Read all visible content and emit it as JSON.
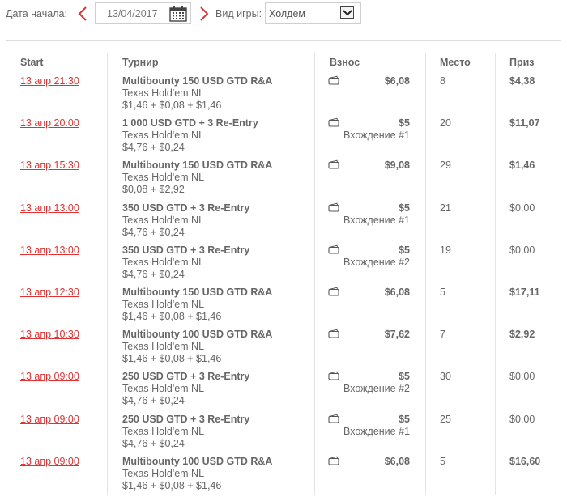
{
  "filters": {
    "date_label": "Дата начала:",
    "date_value": "13/04/2017",
    "game_label": "Вид игры:",
    "game_value": "Холдем"
  },
  "columns": {
    "start": "Start",
    "tournament": "Турнир",
    "buyin": "Взнос",
    "place": "Место",
    "prize": "Приз"
  },
  "rows": [
    {
      "start": "13 апр 21:30",
      "name": "Multibounty 150 USD GTD R&A",
      "game": "Texas Hold'em NL",
      "fee": "$1,46 + $0,08 + $1,46",
      "buyin": "$6,08",
      "entry": "",
      "place": "8",
      "prize": "$4,38",
      "won": true
    },
    {
      "start": "13 апр 20:00",
      "name": "1 000 USD GTD + 3 Re-Entry",
      "game": "Texas Hold'em NL",
      "fee": "$4,76 + $0,24",
      "buyin": "$5",
      "entry": "Вхождение #1",
      "place": "20",
      "prize": "$11,07",
      "won": true
    },
    {
      "start": "13 апр 15:30",
      "name": "Multibounty 150 USD GTD R&A",
      "game": "Texas Hold'em NL",
      "fee": "$0,08 + $2,92",
      "buyin": "$9,08",
      "entry": "",
      "place": "29",
      "prize": "$1,46",
      "won": true
    },
    {
      "start": "13 апр 13:00",
      "name": "350 USD GTD + 3 Re-Entry",
      "game": "Texas Hold'em NL",
      "fee": "$4,76 + $0,24",
      "buyin": "$5",
      "entry": "Вхождение #1",
      "place": "21",
      "prize": "$0,00",
      "won": false
    },
    {
      "start": "13 апр 13:00",
      "name": "350 USD GTD + 3 Re-Entry",
      "game": "Texas Hold'em NL",
      "fee": "$4,76 + $0,24",
      "buyin": "$5",
      "entry": "Вхождение #2",
      "place": "19",
      "prize": "$0,00",
      "won": false
    },
    {
      "start": "13 апр 12:30",
      "name": "Multibounty 150 USD GTD R&A",
      "game": "Texas Hold'em NL",
      "fee": "$1,46 + $0,08 + $1,46",
      "buyin": "$6,08",
      "entry": "",
      "place": "5",
      "prize": "$17,11",
      "won": true
    },
    {
      "start": "13 апр 10:30",
      "name": "Multibounty 100 USD GTD R&A",
      "game": "Texas Hold'em NL",
      "fee": "$1,46 + $0,08 + $1,46",
      "buyin": "$7,62",
      "entry": "",
      "place": "7",
      "prize": "$2,92",
      "won": true
    },
    {
      "start": "13 апр 09:00",
      "name": "250 USD GTD + 3 Re-Entry",
      "game": "Texas Hold'em NL",
      "fee": "$4,76 + $0,24",
      "buyin": "$5",
      "entry": "Вхождение #2",
      "place": "30",
      "prize": "$0,00",
      "won": false
    },
    {
      "start": "13 апр 09:00",
      "name": "250 USD GTD + 3 Re-Entry",
      "game": "Texas Hold'em NL",
      "fee": "$4,76 + $0,24",
      "buyin": "$5",
      "entry": "Вхождение #1",
      "place": "25",
      "prize": "$0,00",
      "won": false
    },
    {
      "start": "13 апр 09:00",
      "name": "Multibounty 100 USD GTD R&A",
      "game": "Texas Hold'em NL",
      "fee": "$1,46 + $0,08 + $1,46",
      "buyin": "$6,08",
      "entry": "",
      "place": "5",
      "prize": "$16,60",
      "won": true
    }
  ],
  "icons": {
    "prev": "chevron-left-icon",
    "next": "chevron-right-icon",
    "calendar": "calendar-icon",
    "dropdown": "chevron-down-icon",
    "buyin": "wallet-icon"
  },
  "colors": {
    "accent": "#e53030",
    "text": "#666666",
    "divider": "#e4e4e4"
  }
}
